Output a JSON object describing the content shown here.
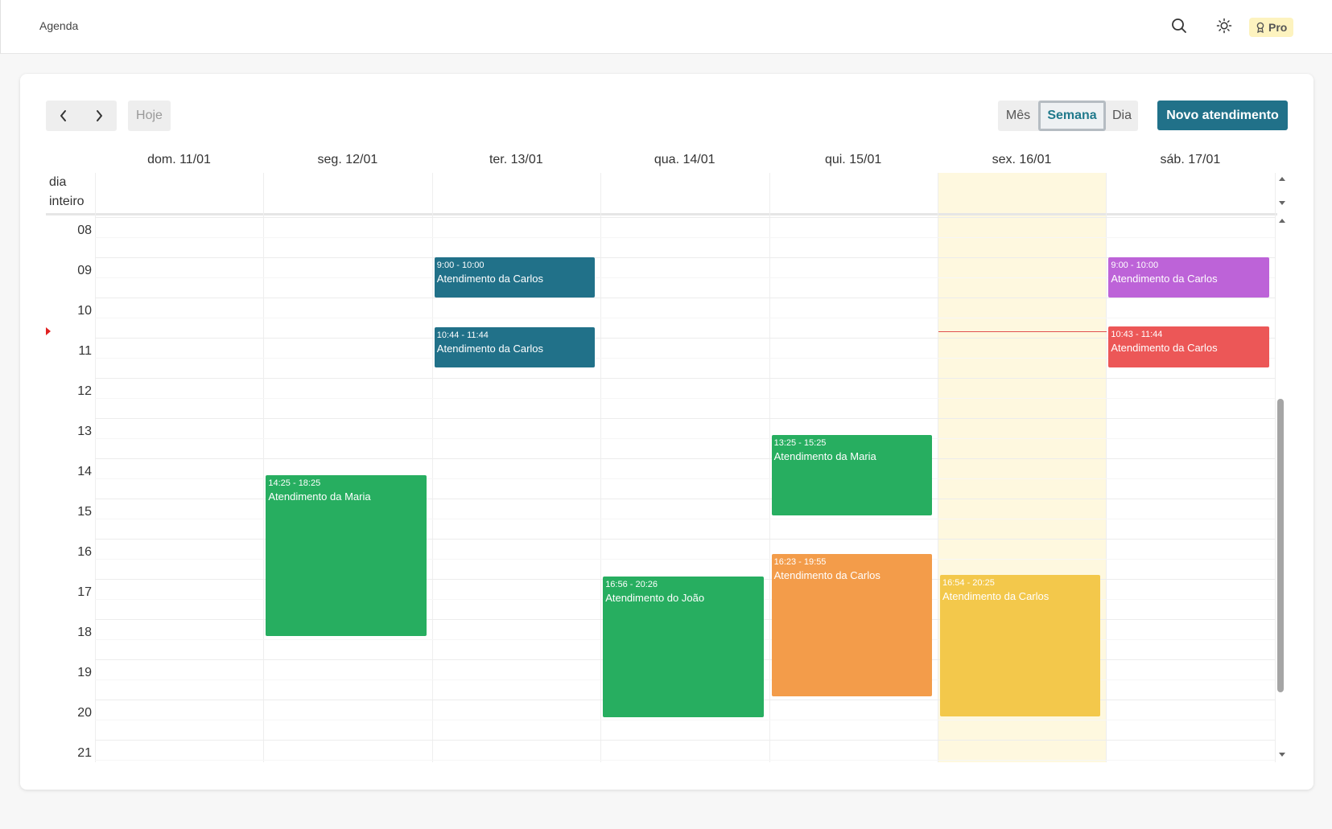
{
  "app": {
    "title": "Agenda"
  },
  "topbar": {
    "pro_label": "Pro"
  },
  "toolbar": {
    "today_label": "Hoje",
    "views": [
      "Mês",
      "Semana",
      "Dia"
    ],
    "active_view": "Semana",
    "new_label": "Novo atendimento"
  },
  "calendar": {
    "days": [
      "dom. 11/01",
      "seg. 12/01",
      "ter. 13/01",
      "qua. 14/01",
      "qui. 15/01",
      "sex. 16/01",
      "sáb. 17/01"
    ],
    "allday_label": [
      "dia",
      "inteiro"
    ],
    "hours": [
      "08",
      "09",
      "10",
      "11",
      "12",
      "13",
      "14",
      "15",
      "16",
      "17",
      "18",
      "19",
      "20",
      "21"
    ],
    "today_index": 5,
    "now": "10:43",
    "events": [
      {
        "day": 2,
        "time": "9:00 - 10:00",
        "title": "Atendimento da Carlos",
        "color": "#217189"
      },
      {
        "day": 2,
        "time": "10:44 - 11:44",
        "title": "Atendimento da Carlos",
        "color": "#217189"
      },
      {
        "day": 6,
        "time": "9:00 - 10:00",
        "title": "Atendimento da Carlos",
        "color": "#bd63d8"
      },
      {
        "day": 6,
        "time": "10:43 - 11:44",
        "title": "Atendimento da Carlos",
        "color": "#ec5757"
      },
      {
        "day": 1,
        "time": "14:25 - 18:25",
        "title": "Atendimento da Maria",
        "color": "#27ae60"
      },
      {
        "day": 4,
        "time": "13:25 - 15:25",
        "title": "Atendimento da Maria",
        "color": "#27ae60"
      },
      {
        "day": 3,
        "time": "16:56 - 20:26",
        "title": "Atendimento do João",
        "color": "#27ae60"
      },
      {
        "day": 4,
        "time": "16:23 - 19:55",
        "title": "Atendimento da Carlos",
        "color": "#f39c4a"
      },
      {
        "day": 5,
        "time": "16:54 - 20:25",
        "title": "Atendimento da Carlos",
        "color": "#f3c84b"
      }
    ]
  }
}
